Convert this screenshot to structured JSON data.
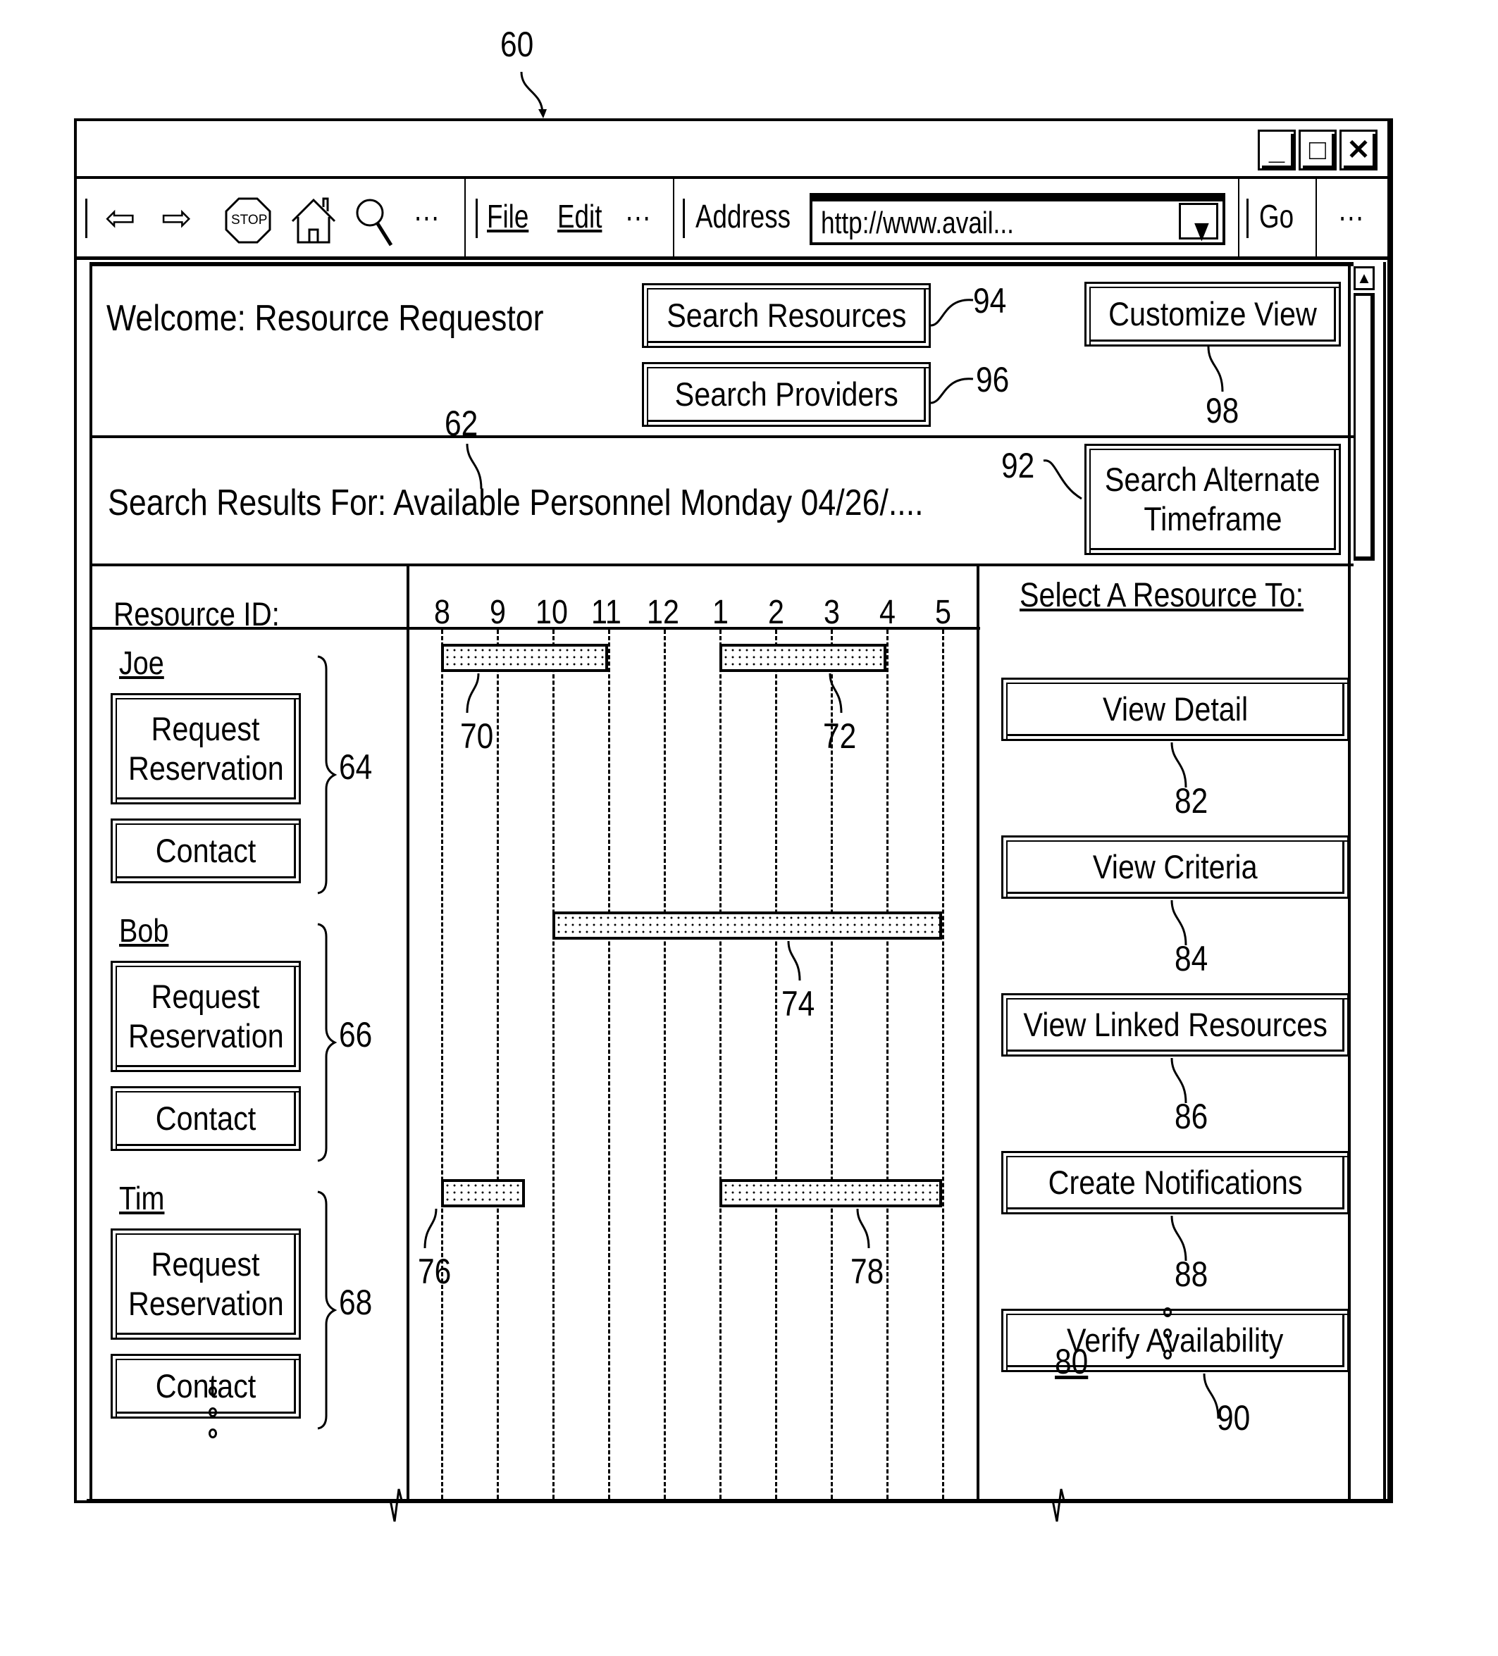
{
  "figure": {
    "window_ref": "60",
    "ref_search_results": "62",
    "ref_joe_group": "64",
    "ref_bob_group": "66",
    "ref_tim_group": "68",
    "ref_action_panel": "80"
  },
  "window": {
    "minimize_icon": "_",
    "maximize_icon": "□",
    "close_icon": "✕"
  },
  "toolbar": {
    "back_icon": "⇦",
    "forward_icon": "⇨",
    "stop_label": "STOP",
    "more1": "···",
    "file_label": "File",
    "edit_label": "Edit",
    "more2": "···",
    "address_label": "Address",
    "address_value": "http://www.avail...",
    "dropdown_icon": "▼",
    "go_label": "Go",
    "more3": "···"
  },
  "header": {
    "welcome": "Welcome: Resource Requestor",
    "search_resources": {
      "label": "Search Resources",
      "ref": "94"
    },
    "search_providers": {
      "label": "Search Providers",
      "ref": "96"
    },
    "customize_view": {
      "label": "Customize View",
      "ref": "98"
    }
  },
  "results": {
    "title": "Search Results For: Available Personnel Monday 04/26/....",
    "alternate_line1": "Search Alternate",
    "alternate_line2": "Timeframe",
    "alternate_ref": "92"
  },
  "schedule": {
    "resource_header": "Resource ID:",
    "hours": [
      "8",
      "9",
      "10",
      "11",
      "12",
      "1",
      "2",
      "3",
      "4",
      "5"
    ],
    "resources": [
      {
        "name": "Joe",
        "request_line1": "Request",
        "request_line2": "Reservation",
        "contact": "Contact",
        "slots": [
          {
            "start": 0,
            "end": 3,
            "ref": "70"
          },
          {
            "start": 5,
            "end": 8,
            "ref": "72"
          }
        ]
      },
      {
        "name": "Bob",
        "request_line1": "Request",
        "request_line2": "Reservation",
        "contact": "Contact",
        "slots": [
          {
            "start": 2,
            "end": 9,
            "ref": "74"
          }
        ]
      },
      {
        "name": "Tim",
        "request_line1": "Request",
        "request_line2": "Reservation",
        "contact": "Contact",
        "slots": [
          {
            "start": 0,
            "end": 1.5,
            "ref": "76"
          },
          {
            "start": 5,
            "end": 9,
            "ref": "78"
          }
        ]
      }
    ]
  },
  "actions": {
    "title": "Select A Resource To:",
    "buttons": [
      {
        "label": "View Detail",
        "ref": "82"
      },
      {
        "label": "View Criteria",
        "ref": "84"
      },
      {
        "label": "View Linked Resources",
        "ref": "86"
      },
      {
        "label": "Create Notifications",
        "ref": "88"
      },
      {
        "label": "Verify Availability",
        "ref": "90"
      }
    ]
  },
  "scrollbar": {
    "up_icon": "▲"
  }
}
